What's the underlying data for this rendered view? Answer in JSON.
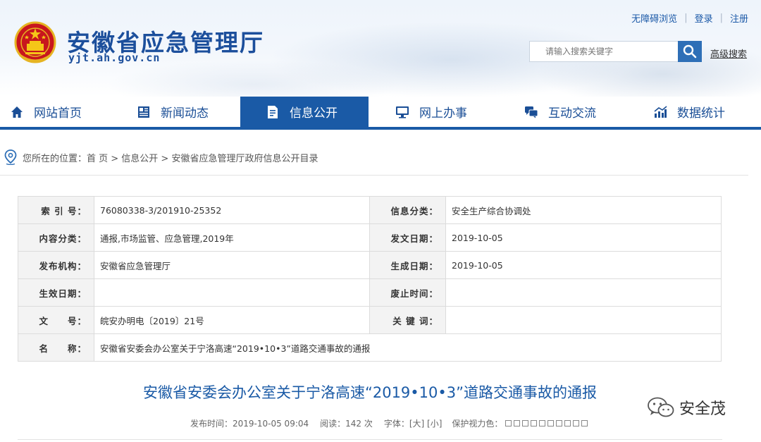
{
  "header": {
    "site_title": "安徽省应急管理厅",
    "site_url": "yjt.ah.gov.cn",
    "emblem_icon": "national-emblem-icon",
    "top_links": [
      "无障碍浏览",
      "登录",
      "注册"
    ],
    "search_placeholder": "请输入搜索关键字",
    "advanced_search": "高级搜索"
  },
  "nav": {
    "items": [
      {
        "label": "网站首页",
        "icon": "home-icon"
      },
      {
        "label": "新闻动态",
        "icon": "news-icon"
      },
      {
        "label": "信息公开",
        "icon": "document-icon",
        "active": true
      },
      {
        "label": "网上办事",
        "icon": "monitor-icon"
      },
      {
        "label": "互动交流",
        "icon": "chat-icon"
      },
      {
        "label": "数据统计",
        "icon": "chart-icon"
      }
    ],
    "accent_color": "#1a5aa6"
  },
  "breadcrumb": {
    "text": "您所在的位置：首 页 > 信息公开 > 安徽省应急管理厅政府信息公开目录"
  },
  "info_table": {
    "rows": [
      {
        "l1": "索 引 号：",
        "v1": "76080338-3/201910-25352",
        "l2": "信息分类：",
        "v2": "安全生产综合协调处"
      },
      {
        "l1": "内容分类：",
        "v1": "通报,市场监管、应急管理,2019年",
        "l2": "发文日期：",
        "v2": "2019-10-05"
      },
      {
        "l1": "发布机构：",
        "v1": "安徽省应急管理厅",
        "l2": "生成日期：",
        "v2": "2019-10-05"
      },
      {
        "l1": "生效日期：",
        "v1": "",
        "l2": "废止时间：",
        "v2": ""
      },
      {
        "l1": "文　　号：",
        "v1": "皖安办明电〔2019〕21号",
        "l2": "关 键 词：",
        "v2": ""
      }
    ],
    "name_label": "名　　称：",
    "name_value": "安徽省安委会办公室关于宁洛高速“2019•10•3”道路交通事故的通报"
  },
  "article": {
    "title": "安徽省安委会办公室关于宁洛高速“2019•10•3”道路交通事故的通报",
    "publish_time": "发布时间：2019-10-05 09:04",
    "reads": "阅读：142 次",
    "font_size_label": "字体：[大] [小]",
    "eye_care_label": "保护视力色："
  },
  "watermark": {
    "text": "安全茂",
    "icon": "wechat-icon"
  }
}
